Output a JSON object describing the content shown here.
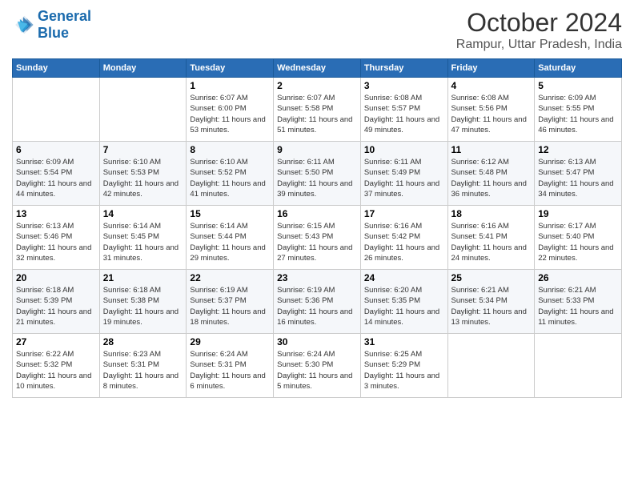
{
  "logo": {
    "line1": "General",
    "line2": "Blue"
  },
  "title": "October 2024",
  "location": "Rampur, Uttar Pradesh, India",
  "days_header": [
    "Sunday",
    "Monday",
    "Tuesday",
    "Wednesday",
    "Thursday",
    "Friday",
    "Saturday"
  ],
  "weeks": [
    [
      {
        "day": "",
        "info": ""
      },
      {
        "day": "",
        "info": ""
      },
      {
        "day": "1",
        "info": "Sunrise: 6:07 AM\nSunset: 6:00 PM\nDaylight: 11 hours and 53 minutes."
      },
      {
        "day": "2",
        "info": "Sunrise: 6:07 AM\nSunset: 5:58 PM\nDaylight: 11 hours and 51 minutes."
      },
      {
        "day": "3",
        "info": "Sunrise: 6:08 AM\nSunset: 5:57 PM\nDaylight: 11 hours and 49 minutes."
      },
      {
        "day": "4",
        "info": "Sunrise: 6:08 AM\nSunset: 5:56 PM\nDaylight: 11 hours and 47 minutes."
      },
      {
        "day": "5",
        "info": "Sunrise: 6:09 AM\nSunset: 5:55 PM\nDaylight: 11 hours and 46 minutes."
      }
    ],
    [
      {
        "day": "6",
        "info": "Sunrise: 6:09 AM\nSunset: 5:54 PM\nDaylight: 11 hours and 44 minutes."
      },
      {
        "day": "7",
        "info": "Sunrise: 6:10 AM\nSunset: 5:53 PM\nDaylight: 11 hours and 42 minutes."
      },
      {
        "day": "8",
        "info": "Sunrise: 6:10 AM\nSunset: 5:52 PM\nDaylight: 11 hours and 41 minutes."
      },
      {
        "day": "9",
        "info": "Sunrise: 6:11 AM\nSunset: 5:50 PM\nDaylight: 11 hours and 39 minutes."
      },
      {
        "day": "10",
        "info": "Sunrise: 6:11 AM\nSunset: 5:49 PM\nDaylight: 11 hours and 37 minutes."
      },
      {
        "day": "11",
        "info": "Sunrise: 6:12 AM\nSunset: 5:48 PM\nDaylight: 11 hours and 36 minutes."
      },
      {
        "day": "12",
        "info": "Sunrise: 6:13 AM\nSunset: 5:47 PM\nDaylight: 11 hours and 34 minutes."
      }
    ],
    [
      {
        "day": "13",
        "info": "Sunrise: 6:13 AM\nSunset: 5:46 PM\nDaylight: 11 hours and 32 minutes."
      },
      {
        "day": "14",
        "info": "Sunrise: 6:14 AM\nSunset: 5:45 PM\nDaylight: 11 hours and 31 minutes."
      },
      {
        "day": "15",
        "info": "Sunrise: 6:14 AM\nSunset: 5:44 PM\nDaylight: 11 hours and 29 minutes."
      },
      {
        "day": "16",
        "info": "Sunrise: 6:15 AM\nSunset: 5:43 PM\nDaylight: 11 hours and 27 minutes."
      },
      {
        "day": "17",
        "info": "Sunrise: 6:16 AM\nSunset: 5:42 PM\nDaylight: 11 hours and 26 minutes."
      },
      {
        "day": "18",
        "info": "Sunrise: 6:16 AM\nSunset: 5:41 PM\nDaylight: 11 hours and 24 minutes."
      },
      {
        "day": "19",
        "info": "Sunrise: 6:17 AM\nSunset: 5:40 PM\nDaylight: 11 hours and 22 minutes."
      }
    ],
    [
      {
        "day": "20",
        "info": "Sunrise: 6:18 AM\nSunset: 5:39 PM\nDaylight: 11 hours and 21 minutes."
      },
      {
        "day": "21",
        "info": "Sunrise: 6:18 AM\nSunset: 5:38 PM\nDaylight: 11 hours and 19 minutes."
      },
      {
        "day": "22",
        "info": "Sunrise: 6:19 AM\nSunset: 5:37 PM\nDaylight: 11 hours and 18 minutes."
      },
      {
        "day": "23",
        "info": "Sunrise: 6:19 AM\nSunset: 5:36 PM\nDaylight: 11 hours and 16 minutes."
      },
      {
        "day": "24",
        "info": "Sunrise: 6:20 AM\nSunset: 5:35 PM\nDaylight: 11 hours and 14 minutes."
      },
      {
        "day": "25",
        "info": "Sunrise: 6:21 AM\nSunset: 5:34 PM\nDaylight: 11 hours and 13 minutes."
      },
      {
        "day": "26",
        "info": "Sunrise: 6:21 AM\nSunset: 5:33 PM\nDaylight: 11 hours and 11 minutes."
      }
    ],
    [
      {
        "day": "27",
        "info": "Sunrise: 6:22 AM\nSunset: 5:32 PM\nDaylight: 11 hours and 10 minutes."
      },
      {
        "day": "28",
        "info": "Sunrise: 6:23 AM\nSunset: 5:31 PM\nDaylight: 11 hours and 8 minutes."
      },
      {
        "day": "29",
        "info": "Sunrise: 6:24 AM\nSunset: 5:31 PM\nDaylight: 11 hours and 6 minutes."
      },
      {
        "day": "30",
        "info": "Sunrise: 6:24 AM\nSunset: 5:30 PM\nDaylight: 11 hours and 5 minutes."
      },
      {
        "day": "31",
        "info": "Sunrise: 6:25 AM\nSunset: 5:29 PM\nDaylight: 11 hours and 3 minutes."
      },
      {
        "day": "",
        "info": ""
      },
      {
        "day": "",
        "info": ""
      }
    ]
  ]
}
